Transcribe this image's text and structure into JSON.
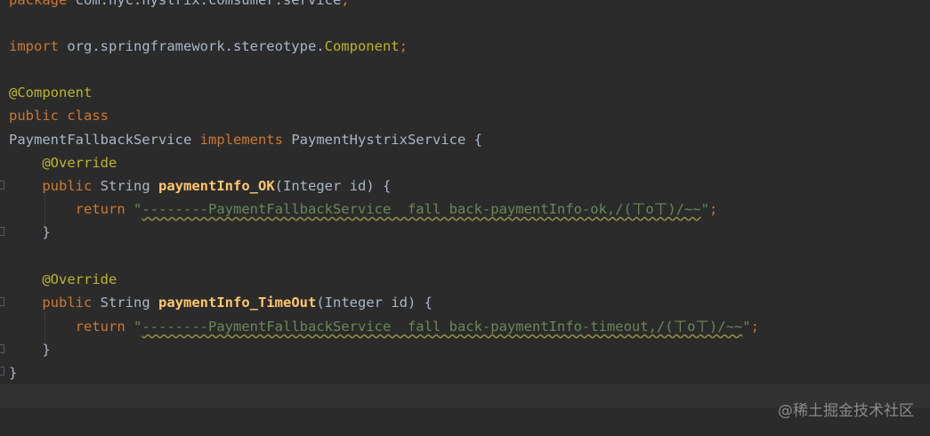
{
  "code": {
    "package_kw": "package",
    "package_name": "com.hyc.hystrix.comsumer.service",
    "import_kw": "import",
    "import_path": "org.springframework.stereotype.",
    "import_class": "Component",
    "component_annotation": "@Component",
    "public_kw": "public",
    "class_kw": "class",
    "class_name": "PaymentFallbackService",
    "implements_kw": "implements",
    "interface_name": "PaymentHystrixService",
    "override_annotation": "@Override",
    "string_type": "String",
    "method1_name": "paymentInfo_OK",
    "method2_name": "paymentInfo_TimeOut",
    "param_type": "Integer",
    "param_name": "id",
    "return_kw": "return",
    "return1_string": "--------PaymentFallbackService  fall back-paymentInfo-ok,/(ㄒoㄒ)/~~",
    "return2_string": "--------PaymentFallbackService  fall back-paymentInfo-timeout,/(ㄒoㄒ)/~~"
  },
  "watermark": "@稀土掘金技术社区"
}
